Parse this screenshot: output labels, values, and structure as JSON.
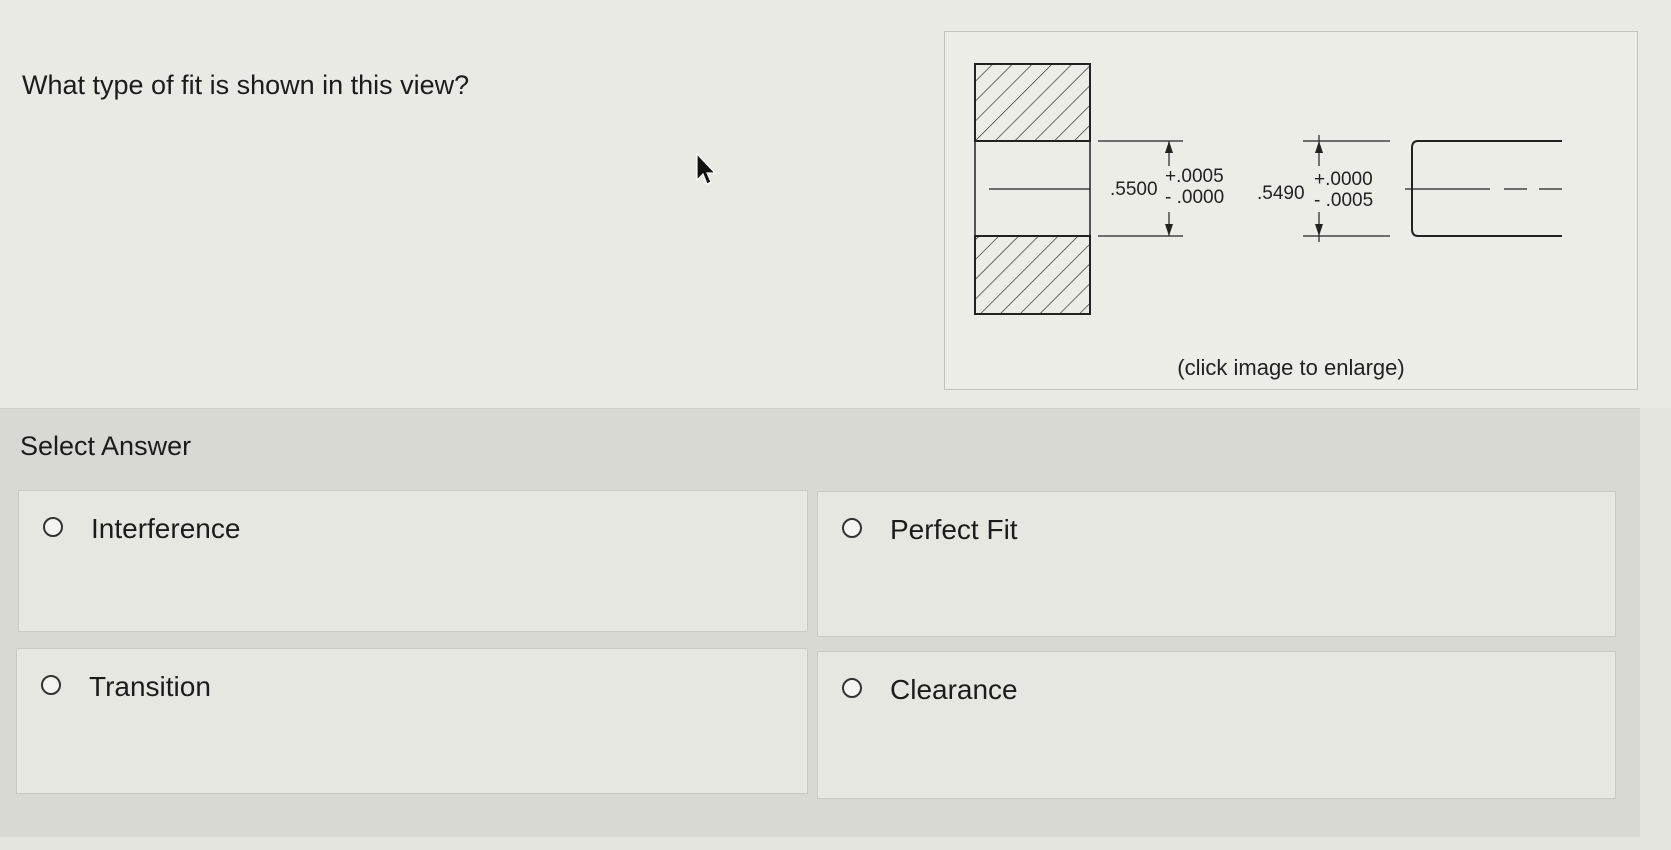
{
  "question": {
    "text": "What type of fit is shown in this view?"
  },
  "figure": {
    "hole_dimension": ".5500",
    "hole_tolerance_upper": "+.0005",
    "hole_tolerance_lower": "- .0000",
    "shaft_dimension": ".5490",
    "shaft_tolerance_upper": "+.0000",
    "shaft_tolerance_lower": "- .0005",
    "caption": "(click image to enlarge)"
  },
  "answers": {
    "heading": "Select Answer",
    "options": [
      {
        "label": "Interference",
        "selected": false
      },
      {
        "label": "Perfect Fit",
        "selected": false
      },
      {
        "label": "Transition",
        "selected": false
      },
      {
        "label": "Clearance",
        "selected": false
      }
    ]
  }
}
